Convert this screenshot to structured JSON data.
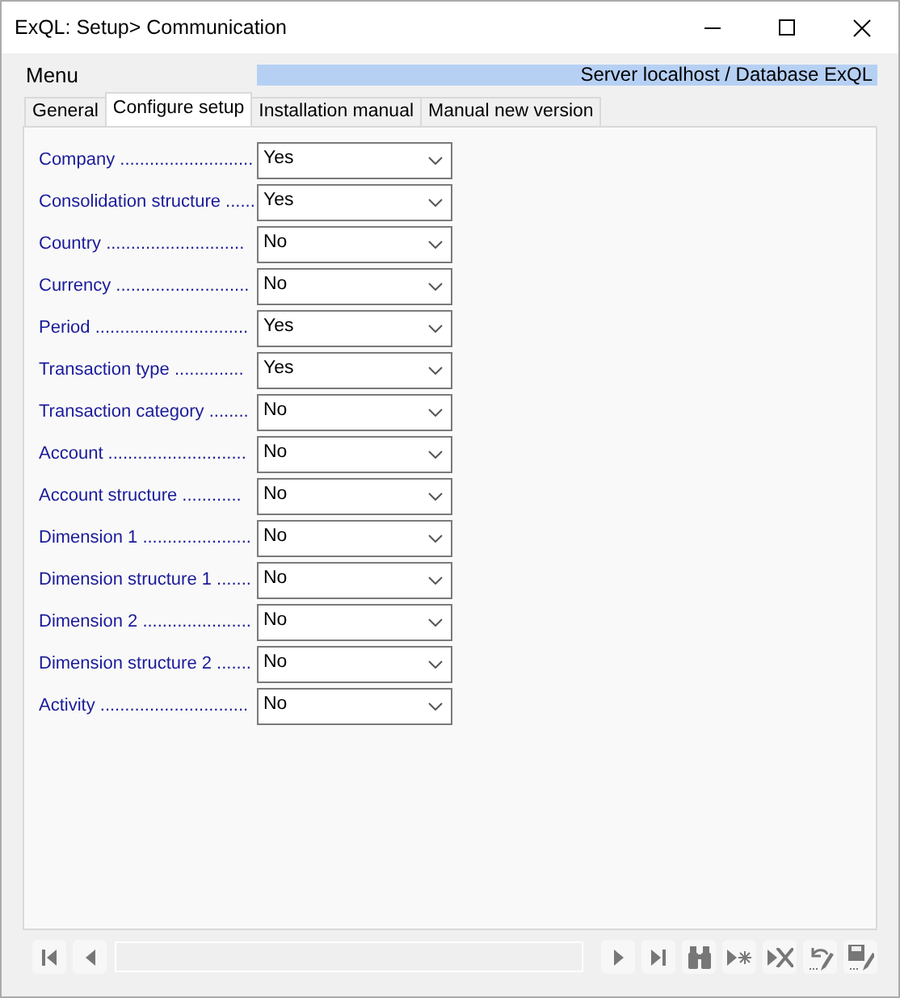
{
  "window": {
    "title": "ExQL: Setup> Communication"
  },
  "menu": {
    "label": "Menu"
  },
  "server_info": "Server localhost / Database ExQL",
  "tabs": [
    {
      "label": "General",
      "selected": false
    },
    {
      "label": "Configure setup",
      "selected": true
    },
    {
      "label": "Installation manual",
      "selected": false
    },
    {
      "label": "Manual new version",
      "selected": false
    }
  ],
  "settings": [
    {
      "label": "Company ...........................",
      "value": "Yes"
    },
    {
      "label": "Consolidation structure ......",
      "value": "Yes"
    },
    {
      "label": "Country ............................",
      "value": "No"
    },
    {
      "label": "Currency ...........................",
      "value": "No"
    },
    {
      "label": "Period ...............................",
      "value": "Yes"
    },
    {
      "label": "Transaction type ..............",
      "value": "Yes"
    },
    {
      "label": "Transaction category ........",
      "value": "No"
    },
    {
      "label": "Account ............................",
      "value": "No"
    },
    {
      "label": "Account structure ............",
      "value": "No"
    },
    {
      "label": "Dimension 1 ......................",
      "value": "No"
    },
    {
      "label": "Dimension structure 1 .......",
      "value": "No"
    },
    {
      "label": "Dimension 2 ......................",
      "value": "No"
    },
    {
      "label": "Dimension structure 2 .......",
      "value": "No"
    },
    {
      "label": "Activity ..............................",
      "value": "No"
    }
  ],
  "navigator": {
    "buttons": [
      {
        "kind": "first"
      },
      {
        "kind": "prev"
      },
      {
        "kind": "field"
      },
      {
        "kind": "next"
      },
      {
        "kind": "last"
      },
      {
        "kind": "find"
      },
      {
        "kind": "new"
      },
      {
        "kind": "delete"
      },
      {
        "kind": "undo"
      },
      {
        "kind": "save"
      }
    ]
  }
}
